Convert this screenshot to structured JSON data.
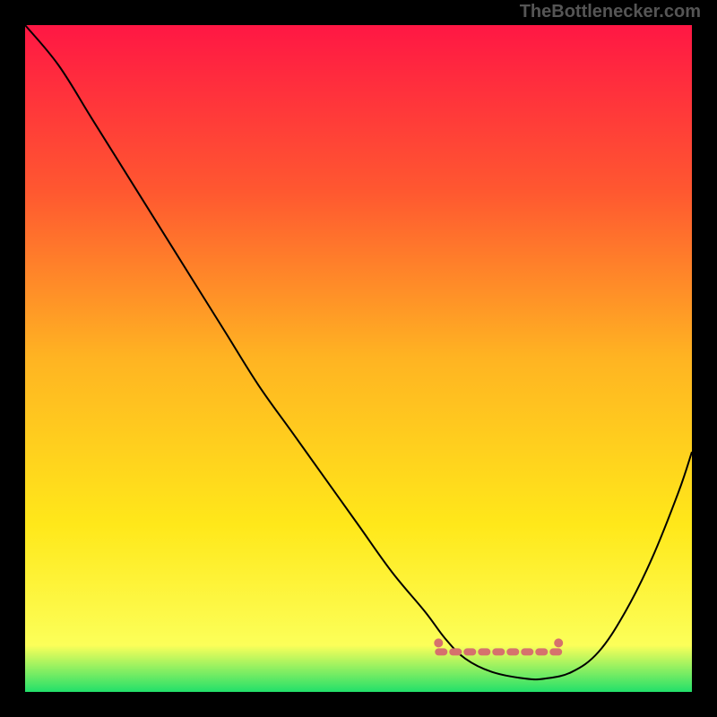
{
  "watermark": "TheBottlenecker.com",
  "chart_data": {
    "type": "line",
    "title": "",
    "xlabel": "",
    "ylabel": "",
    "xlim": [
      0,
      100
    ],
    "ylim": [
      0,
      100
    ],
    "background_gradient": {
      "stops": [
        {
          "offset": 0,
          "color": "#ff1744"
        },
        {
          "offset": 25,
          "color": "#ff5830"
        },
        {
          "offset": 50,
          "color": "#ffb422"
        },
        {
          "offset": 75,
          "color": "#ffe81a"
        },
        {
          "offset": 93,
          "color": "#fcff59"
        },
        {
          "offset": 100,
          "color": "#22e06a"
        }
      ]
    },
    "series": [
      {
        "name": "bottleneck-curve",
        "color": "#000000",
        "width": 2,
        "x": [
          0,
          5,
          10,
          15,
          20,
          25,
          30,
          35,
          40,
          45,
          50,
          55,
          60,
          63,
          66,
          70,
          75,
          78,
          82,
          86,
          90,
          94,
          98,
          100
        ],
        "y": [
          100,
          94,
          86,
          78,
          70,
          62,
          54,
          46,
          39,
          32,
          25,
          18,
          12,
          8,
          5,
          3,
          2,
          2,
          3,
          6,
          12,
          20,
          30,
          36
        ]
      }
    ],
    "marker_band": {
      "name": "optimal-range",
      "color": "#d6716d",
      "x_start": 62,
      "x_end": 80,
      "y": 6
    }
  }
}
